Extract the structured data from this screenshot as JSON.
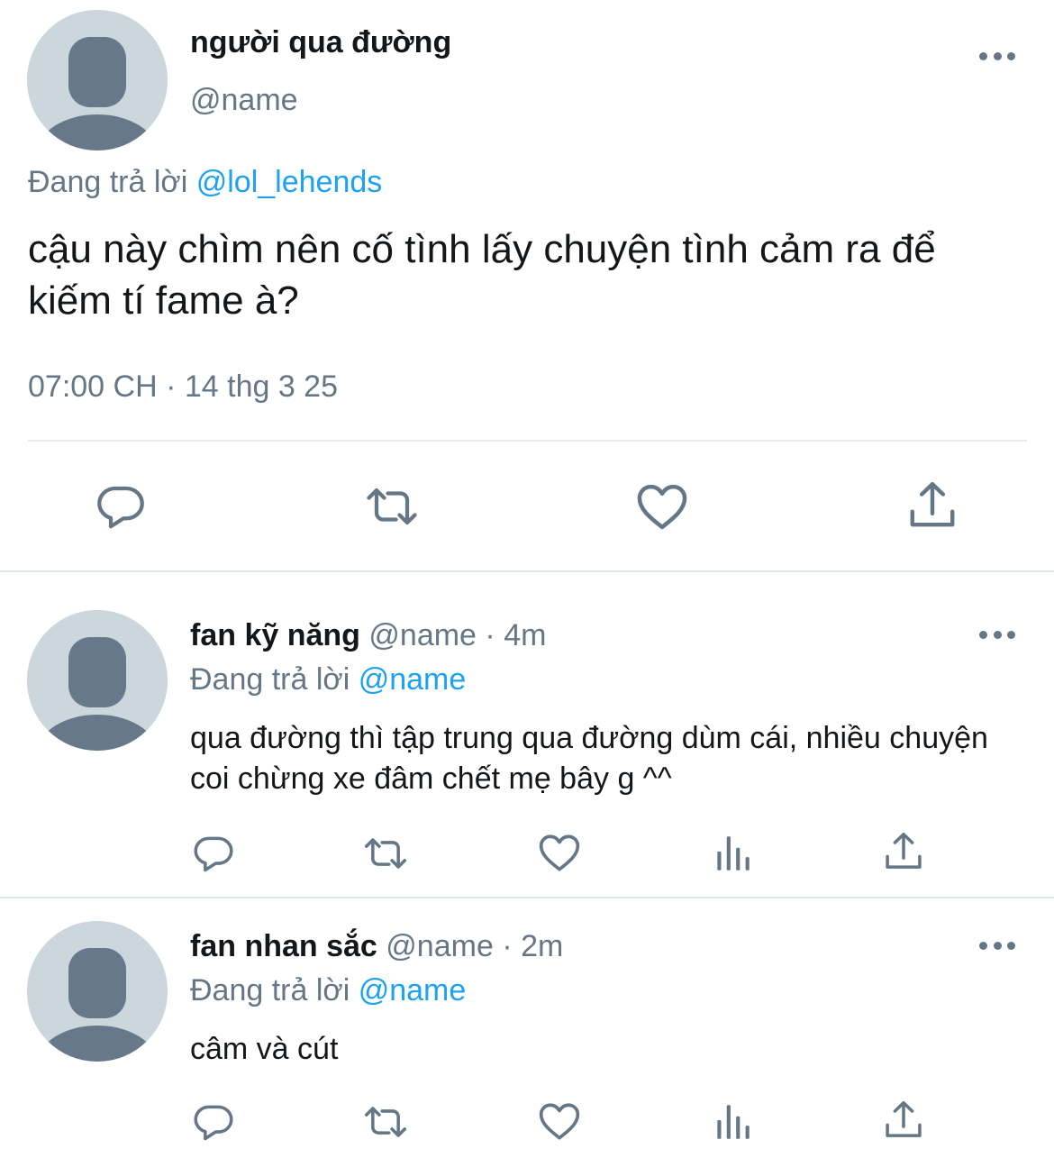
{
  "main_tweet": {
    "display_name": "người qua đường",
    "handle": "@name",
    "replying_prefix": "Đang trả lời",
    "replying_to": "@lol_lehends",
    "text": "cậu này chìm nên cố tình lấy chuyện tình cảm ra để kiếm tí fame à?",
    "timestamp": "07:00 CH · 14 thg 3 25",
    "actions": [
      "reply-icon",
      "retweet-icon",
      "like-icon",
      "share-icon"
    ]
  },
  "replies": [
    {
      "display_name": "fan kỹ năng",
      "handle": "@name",
      "separator": "·",
      "time": "4m",
      "replying_prefix": "Đang trả lời",
      "replying_to": "@name",
      "text": "qua đường thì tập trung qua đường dùm cái, nhiều chuyện coi chừng xe đâm chết mẹ bây g ^^",
      "actions": [
        "reply-icon",
        "retweet-icon",
        "like-icon",
        "analytics-icon",
        "share-icon"
      ]
    },
    {
      "display_name": "fan nhan sắc",
      "handle": "@name",
      "separator": "·",
      "time": "2m",
      "replying_prefix": "Đang trả lời",
      "replying_to": "@name",
      "text": "câm và cút",
      "actions": [
        "reply-icon",
        "retweet-icon",
        "like-icon",
        "analytics-icon",
        "share-icon"
      ]
    }
  ],
  "colors": {
    "text": "#14171a",
    "secondary": "#657786",
    "link": "#1da1f2",
    "avatar_bg": "#ccd6dd",
    "avatar_fg": "#66788a",
    "divider": "#e1e8ed"
  }
}
